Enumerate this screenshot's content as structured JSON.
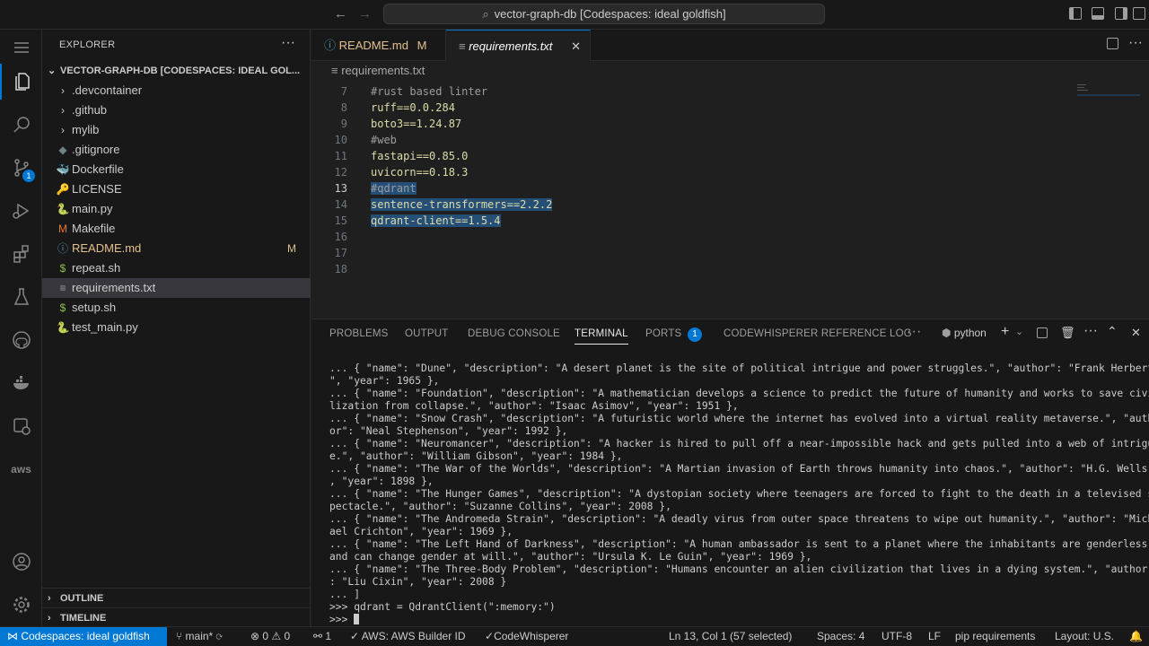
{
  "titlebar": {
    "search_text": "vector-graph-db [Codespaces: ideal goldfish]"
  },
  "activity": {
    "scm_badge": "1"
  },
  "sidebar": {
    "header": "EXPLORER",
    "root": "VECTOR-GRAPH-DB [CODESPACES: IDEAL GOL...",
    "items": [
      {
        "label": ".devcontainer",
        "kind": "folder"
      },
      {
        "label": ".github",
        "kind": "folder"
      },
      {
        "label": "mylib",
        "kind": "folder"
      },
      {
        "label": ".gitignore",
        "kind": "file"
      },
      {
        "label": "Dockerfile",
        "kind": "file"
      },
      {
        "label": "LICENSE",
        "kind": "file"
      },
      {
        "label": "main.py",
        "kind": "file"
      },
      {
        "label": "Makefile",
        "kind": "file"
      },
      {
        "label": "README.md",
        "kind": "file",
        "decoration": "M"
      },
      {
        "label": "repeat.sh",
        "kind": "file"
      },
      {
        "label": "requirements.txt",
        "kind": "file"
      },
      {
        "label": "setup.sh",
        "kind": "file"
      },
      {
        "label": "test_main.py",
        "kind": "file"
      }
    ],
    "outline": "OUTLINE",
    "timeline": "TIMELINE"
  },
  "tabs": [
    {
      "label": "README.md",
      "decoration": "M"
    },
    {
      "label": "requirements.txt"
    }
  ],
  "breadcrumb": "requirements.txt",
  "editor": {
    "lines": [
      {
        "num": "7",
        "text": "#rust based linter"
      },
      {
        "num": "8",
        "text": "ruff==0.0.284"
      },
      {
        "num": "9",
        "text": "boto3==1.24.87"
      },
      {
        "num": "10",
        "text": "#web"
      },
      {
        "num": "11",
        "text": "fastapi==0.85.0"
      },
      {
        "num": "12",
        "text": "uvicorn==0.18.3"
      },
      {
        "num": "13",
        "text": "#qdrant"
      },
      {
        "num": "14",
        "text": "sentence-transformers==2.2.2"
      },
      {
        "num": "15",
        "text": "qdrant-client==1.5.4"
      },
      {
        "num": "16",
        "text": ""
      },
      {
        "num": "17",
        "text": ""
      },
      {
        "num": "18",
        "text": ""
      }
    ]
  },
  "panel": {
    "tabs": [
      "PROBLEMS",
      "OUTPUT",
      "DEBUG CONSOLE",
      "TERMINAL",
      "PORTS",
      "CODEWHISPERER REFERENCE LOG"
    ],
    "ports_badge": "1",
    "shell": "python",
    "terminal_lines": [
      "... { \"name\": \"Dune\", \"description\": \"A desert planet is the site of political intrigue and power struggles.\", \"author\": \"Frank Herbert",
      "\", \"year\": 1965 },",
      "... { \"name\": \"Foundation\", \"description\": \"A mathematician develops a science to predict the future of humanity and works to save civi",
      "lization from collapse.\", \"author\": \"Isaac Asimov\", \"year\": 1951 },",
      "... { \"name\": \"Snow Crash\", \"description\": \"A futuristic world where the internet has evolved into a virtual reality metaverse.\", \"auth",
      "or\": \"Neal Stephenson\", \"year\": 1992 },",
      "... { \"name\": \"Neuromancer\", \"description\": \"A hacker is hired to pull off a near-impossible hack and gets pulled into a web of intrigu",
      "e.\", \"author\": \"William Gibson\", \"year\": 1984 },",
      "... { \"name\": \"The War of the Worlds\", \"description\": \"A Martian invasion of Earth throws humanity into chaos.\", \"author\": \"H.G. Wells\"",
      ", \"year\": 1898 },",
      "... { \"name\": \"The Hunger Games\", \"description\": \"A dystopian society where teenagers are forced to fight to the death in a televised s",
      "pectacle.\", \"author\": \"Suzanne Collins\", \"year\": 2008 },",
      "... { \"name\": \"The Andromeda Strain\", \"description\": \"A deadly virus from outer space threatens to wipe out humanity.\", \"author\": \"Mich",
      "ael Crichton\", \"year\": 1969 },",
      "... { \"name\": \"The Left Hand of Darkness\", \"description\": \"A human ambassador is sent to a planet where the inhabitants are genderless",
      "and can change gender at will.\", \"author\": \"Ursula K. Le Guin\", \"year\": 1969 },",
      "... { \"name\": \"The Three-Body Problem\", \"description\": \"Humans encounter an alien civilization that lives in a dying system.\", \"author\"",
      ": \"Liu Cixin\", \"year\": 2008 }",
      "... ]",
      ">>> qdrant = QdrantClient(\":memory:\")"
    ],
    "prompt": ">>> "
  },
  "status": {
    "remote": "Codespaces: ideal goldfish",
    "branch": "main*",
    "problems": "⊗ 0 ⚠ 0",
    "ports": "1",
    "aws": "AWS: AWS Builder ID",
    "codewhisperer": "CodeWhisperer",
    "position": "Ln 13, Col 1 (57 selected)",
    "spaces": "Spaces: 4",
    "encoding": "UTF-8",
    "eol": "LF",
    "language": "pip requirements",
    "quantum": "Layout: U.S."
  },
  "colors": {
    "accent": "#0078d4",
    "modified": "#e2c08d",
    "code_green": "#dcdcaa"
  }
}
